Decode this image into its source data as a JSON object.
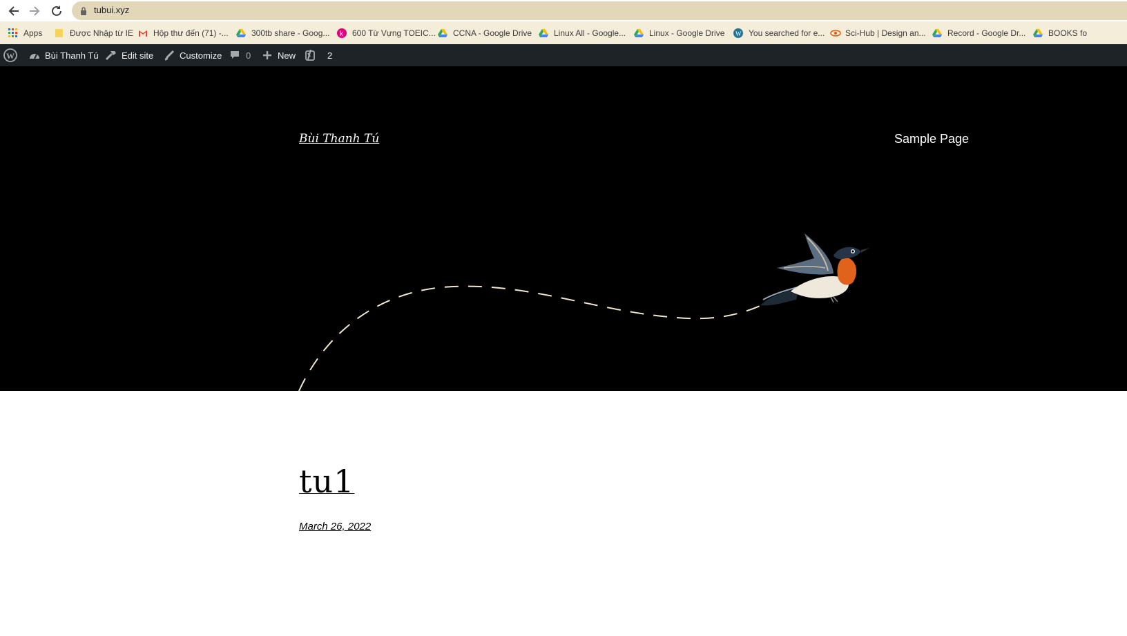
{
  "browser": {
    "url": "tubui.xyz",
    "back_icon": "arrow-left-icon",
    "forward_icon": "arrow-right-icon",
    "reload_icon": "reload-icon"
  },
  "bookmarks": [
    {
      "label": "Apps",
      "icon": "apps-grid-icon"
    },
    {
      "label": "Được Nhập từ IE",
      "icon": "folder-icon"
    },
    {
      "label": "Hộp thư đến (71) -...",
      "icon": "gmail-icon"
    },
    {
      "label": "300tb share - Goog...",
      "icon": "google-drive-icon"
    },
    {
      "label": "600 Từ Vựng TOEIC...",
      "icon": "k-circle-icon"
    },
    {
      "label": "CCNA - Google Drive",
      "icon": "google-drive-icon"
    },
    {
      "label": "Linux All - Google...",
      "icon": "google-drive-icon"
    },
    {
      "label": "Linux - Google Drive",
      "icon": "google-drive-icon"
    },
    {
      "label": "You searched for e...",
      "icon": "wordpress-icon"
    },
    {
      "label": "Sci-Hub | Design an...",
      "icon": "scihub-icon"
    },
    {
      "label": "Record - Google Dr...",
      "icon": "google-drive-icon"
    },
    {
      "label": "BOOKS fo",
      "icon": "google-drive-icon"
    }
  ],
  "adminbar": {
    "site_name": "Bùi Thanh Tú",
    "edit_site": "Edit site",
    "customize": "Customize",
    "comments_count": "0",
    "new_label": "New",
    "yoast_count": "2"
  },
  "header": {
    "site_title": "Bùi Thanh Tú",
    "nav_sample_page": "Sample Page"
  },
  "post": {
    "title": "tu1",
    "date": "March 26, 2022"
  }
}
